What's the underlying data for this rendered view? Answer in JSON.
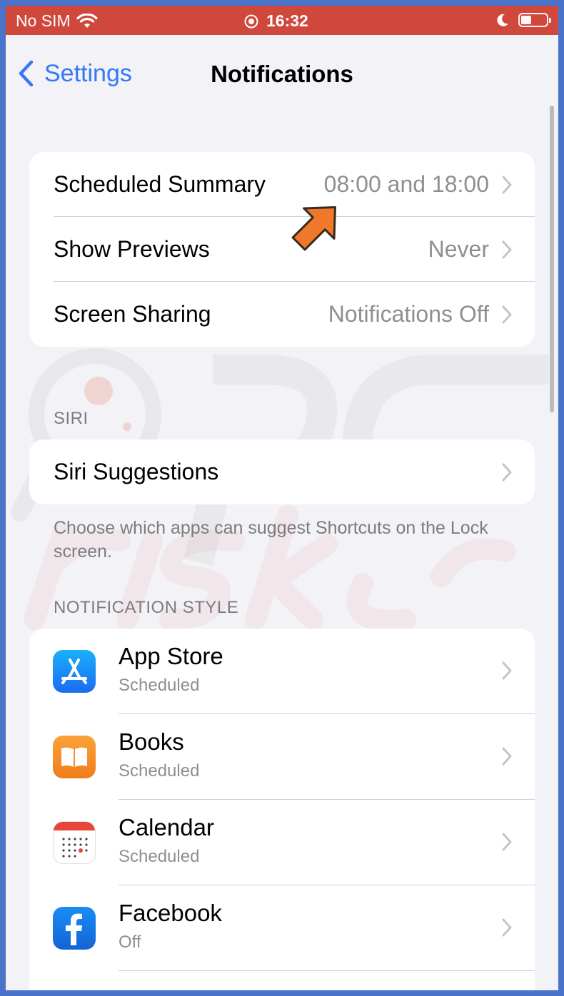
{
  "status_bar": {
    "carrier": "No SIM",
    "time": "16:32",
    "colors": {
      "background": "#d0473b"
    }
  },
  "nav": {
    "back_label": "Settings",
    "title": "Notifications"
  },
  "summary_group": [
    {
      "label": "Scheduled Summary",
      "value": "08:00 and 18:00"
    },
    {
      "label": "Show Previews",
      "value": "Never"
    },
    {
      "label": "Screen Sharing",
      "value": "Notifications Off"
    }
  ],
  "siri": {
    "header": "SIRI",
    "row_label": "Siri Suggestions",
    "footnote": "Choose which apps can suggest Shortcuts on the Lock screen."
  },
  "notification_style": {
    "header": "NOTIFICATION STYLE",
    "apps": [
      {
        "name": "App Store",
        "status": "Scheduled",
        "icon": "app-store-icon"
      },
      {
        "name": "Books",
        "status": "Scheduled",
        "icon": "books-icon"
      },
      {
        "name": "Calendar",
        "status": "Scheduled",
        "icon": "calendar-icon"
      },
      {
        "name": "Facebook",
        "status": "Off",
        "icon": "facebook-icon"
      }
    ]
  },
  "colors": {
    "accent": "#3478f6",
    "secondary_text": "#8e8e93",
    "grouped_background": "#f2f2f7",
    "annotation_arrow": "#f0782a"
  }
}
